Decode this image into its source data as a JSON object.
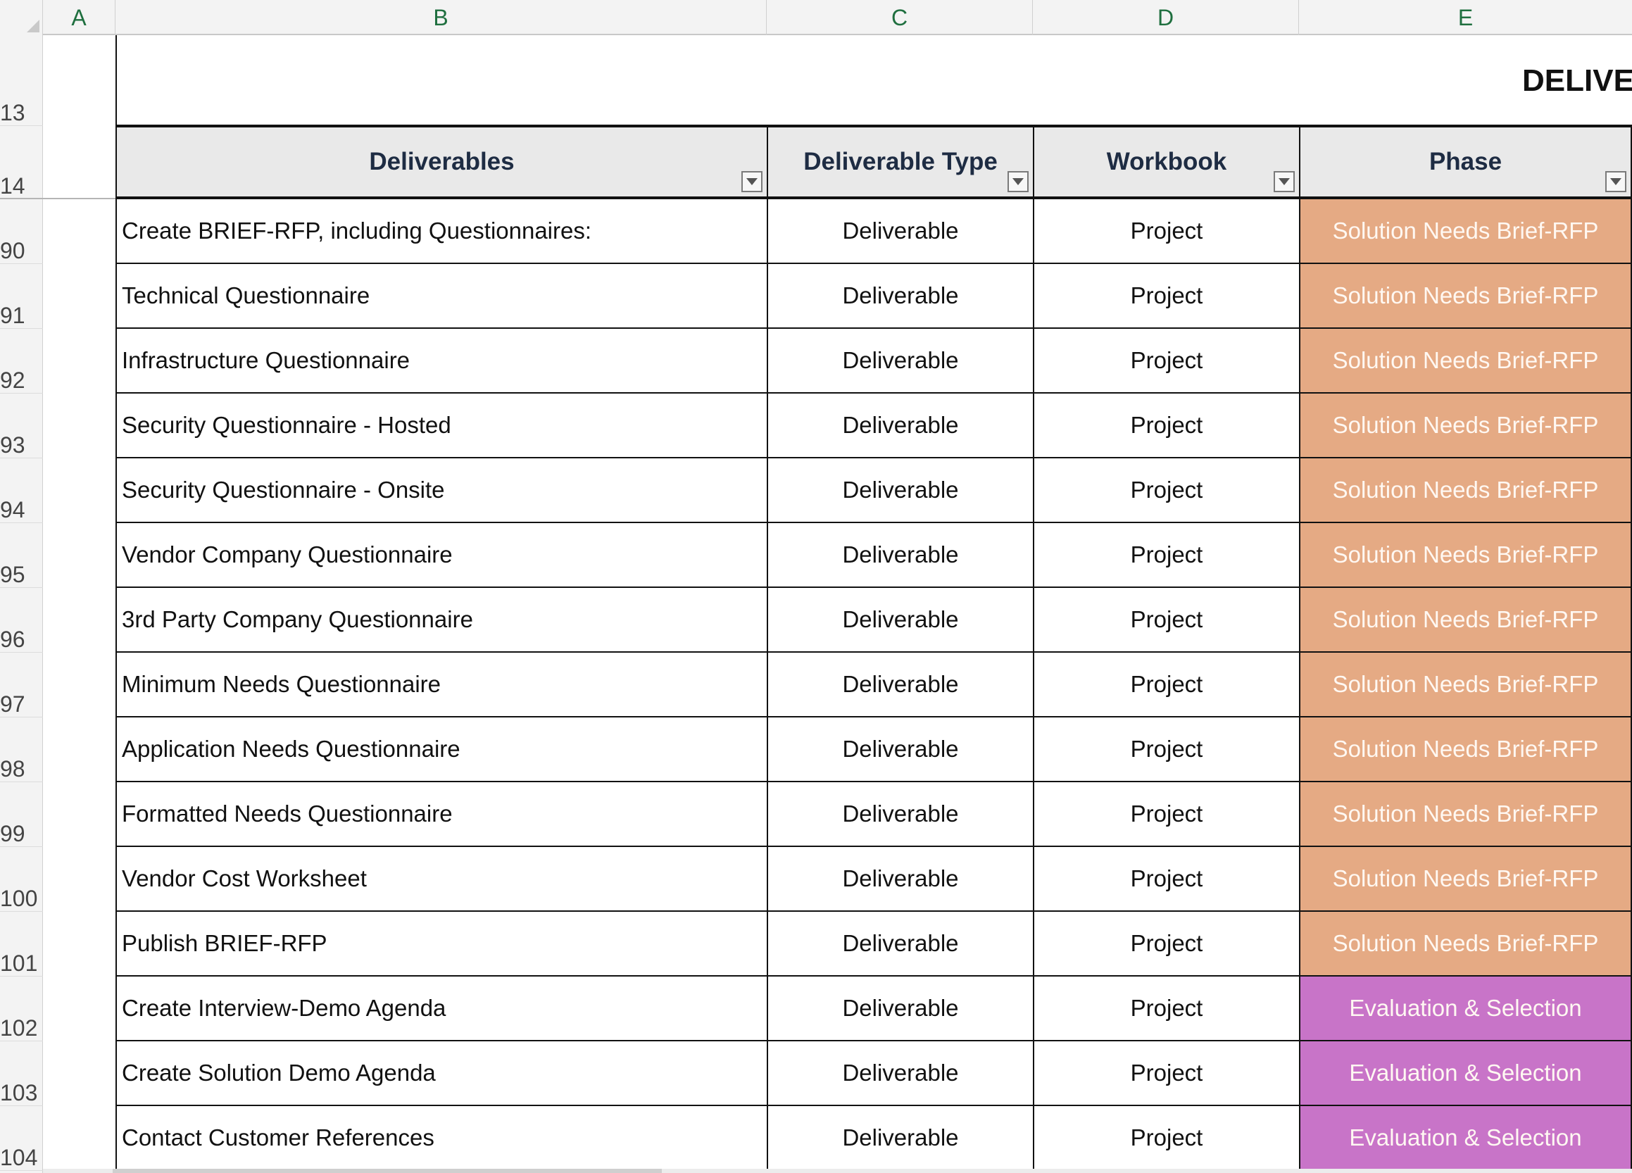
{
  "columns": [
    "A",
    "B",
    "C",
    "D",
    "E"
  ],
  "title_partial": "DELIVE",
  "row_numbers": [
    "13",
    "14",
    "90",
    "91",
    "92",
    "93",
    "94",
    "95",
    "96",
    "97",
    "98",
    "99",
    "100",
    "101",
    "102",
    "103",
    "104"
  ],
  "headers": {
    "deliverables": "Deliverables",
    "deliverable_type": "Deliverable Type",
    "workbook": "Workbook",
    "phase": "Phase"
  },
  "phase_colors": {
    "Solution Needs Brief-RFP": "#e5aa84",
    "Evaluation & Selection": "#c874c8"
  },
  "rows": [
    {
      "row": "90",
      "deliverable": "Create BRIEF-RFP, including Questionnaires:",
      "type": "Deliverable",
      "workbook": "Project",
      "phase": "Solution Needs Brief-RFP"
    },
    {
      "row": "91",
      "deliverable": "Technical Questionnaire",
      "type": "Deliverable",
      "workbook": "Project",
      "phase": "Solution Needs Brief-RFP"
    },
    {
      "row": "92",
      "deliverable": "Infrastructure Questionnaire",
      "type": "Deliverable",
      "workbook": "Project",
      "phase": "Solution Needs Brief-RFP"
    },
    {
      "row": "93",
      "deliverable": "Security Questionnaire - Hosted",
      "type": "Deliverable",
      "workbook": "Project",
      "phase": "Solution Needs Brief-RFP"
    },
    {
      "row": "94",
      "deliverable": "Security Questionnaire - Onsite",
      "type": "Deliverable",
      "workbook": "Project",
      "phase": "Solution Needs Brief-RFP"
    },
    {
      "row": "95",
      "deliverable": "Vendor Company Questionnaire",
      "type": "Deliverable",
      "workbook": "Project",
      "phase": "Solution Needs Brief-RFP"
    },
    {
      "row": "96",
      "deliverable": "3rd Party Company Questionnaire",
      "type": "Deliverable",
      "workbook": "Project",
      "phase": "Solution Needs Brief-RFP"
    },
    {
      "row": "97",
      "deliverable": "Minimum Needs Questionnaire",
      "type": "Deliverable",
      "workbook": "Project",
      "phase": "Solution Needs Brief-RFP"
    },
    {
      "row": "98",
      "deliverable": "Application Needs Questionnaire",
      "type": "Deliverable",
      "workbook": "Project",
      "phase": "Solution Needs Brief-RFP"
    },
    {
      "row": "99",
      "deliverable": "Formatted Needs Questionnaire",
      "type": "Deliverable",
      "workbook": "Project",
      "phase": "Solution Needs Brief-RFP"
    },
    {
      "row": "100",
      "deliverable": "Vendor Cost Worksheet",
      "type": "Deliverable",
      "workbook": "Project",
      "phase": "Solution Needs Brief-RFP"
    },
    {
      "row": "101",
      "deliverable": "Publish BRIEF-RFP",
      "type": "Deliverable",
      "workbook": "Project",
      "phase": "Solution Needs Brief-RFP"
    },
    {
      "row": "102",
      "deliverable": "Create Interview-Demo Agenda",
      "type": "Deliverable",
      "workbook": "Project",
      "phase": "Evaluation & Selection"
    },
    {
      "row": "103",
      "deliverable": "Create Solution Demo Agenda",
      "type": "Deliverable",
      "workbook": "Project",
      "phase": "Evaluation & Selection"
    },
    {
      "row": "104",
      "deliverable": "Contact Customer References",
      "type": "Deliverable",
      "workbook": "Project",
      "phase": "Evaluation & Selection"
    }
  ]
}
